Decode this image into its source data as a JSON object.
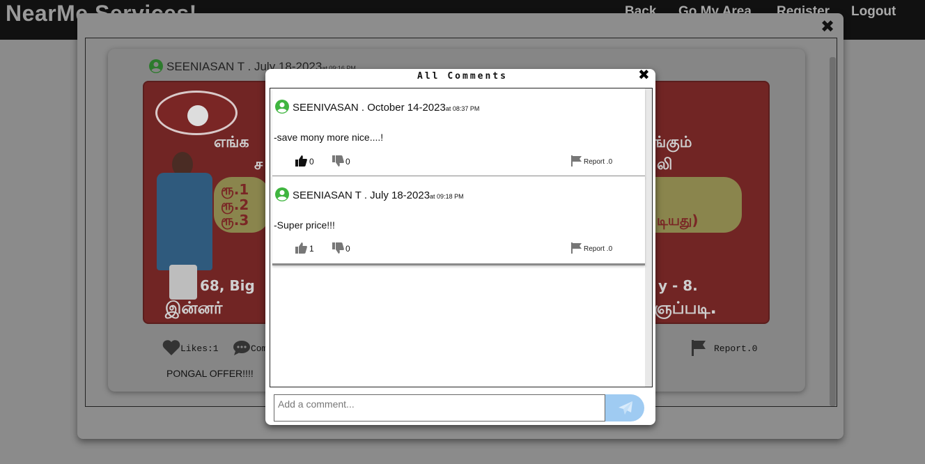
{
  "navbar": {
    "brand": "NearMe Services!",
    "links": [
      "Back",
      "Go My Area",
      "Register",
      "Logout"
    ]
  },
  "post": {
    "author": "SEENIASAN T . July 18-2023",
    "time": "at 09:16 PM",
    "image_text": {
      "line1": "எங்க",
      "line1b": "ங்கும்",
      "line2": "ச",
      "line2b": "லி",
      "price1": "ரூ.1",
      "price2": "ரூ.2",
      "price3": "ரூ.3",
      "price_note": "டியது)",
      "addr_a": "68, Big",
      "addr_b": "y - 8.",
      "bottom_a": "இன்னர்",
      "bottom_b": "ஞப்படி."
    },
    "likes_label": "Likes:1",
    "comments_label": "Com",
    "report_label": "Report.0",
    "caption": "PONGAL OFFER!!!!"
  },
  "comments_modal": {
    "title": "All Comments",
    "comments": [
      {
        "user": "SEENIVASAN . October 14-2023",
        "time": "at 08:37 PM",
        "text": "-save mony more nice....!",
        "likes": "0",
        "dislikes": "0",
        "report": "Report .0"
      },
      {
        "user": "SEENIASAN T . July 18-2023",
        "time": "at 09:18 PM",
        "text": "-Super price!!!",
        "likes": "1",
        "dislikes": "0",
        "report": "Report .0"
      }
    ],
    "input_placeholder": "Add a comment..."
  },
  "colors": {
    "user_icon": "#3fb53f",
    "send_button": "#9fcbf2",
    "navbar": "#111111",
    "post_image_bg": "#712524"
  },
  "icons": {
    "user": "user-circle-icon",
    "like": "thumbs-up-icon",
    "dislike": "thumbs-down-icon",
    "report": "flag-icon",
    "close": "close-icon",
    "send": "paper-plane-icon",
    "heart": "heart-icon",
    "comment": "comment-bubble-icon"
  }
}
